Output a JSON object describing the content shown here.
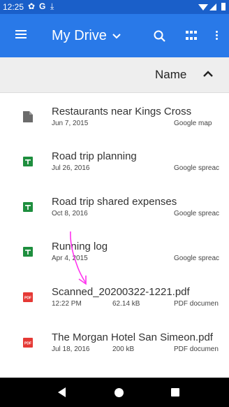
{
  "status_bar": {
    "time": "12:25",
    "icons": [
      "gear-icon",
      "google-g-icon",
      "download-icon",
      "wifi-icon",
      "signal-icon",
      "battery-icon"
    ]
  },
  "app_bar": {
    "title": "My Drive",
    "bg_color": "#2979e8"
  },
  "sort_bar": {
    "label": "Name"
  },
  "files": [
    {
      "name": "Restaurants near Kings Cross",
      "date": "Jun 7, 2015",
      "size": "",
      "type": "Google map",
      "icon": "file-icon"
    },
    {
      "name": "Road trip planning",
      "date": "Jul 26, 2016",
      "size": "",
      "type": "Google spreac",
      "icon": "sheets-icon"
    },
    {
      "name": "Road trip shared expenses",
      "date": "Oct 8, 2016",
      "size": "",
      "type": "Google spreac",
      "icon": "sheets-icon"
    },
    {
      "name": "Running log",
      "date": "Apr 4, 2015",
      "size": "",
      "type": "Google spreac",
      "icon": "sheets-icon"
    },
    {
      "name": "Scanned_20200322-1221.pdf",
      "date": "12:22 PM",
      "size": "62.14 kB",
      "type": "PDF documen",
      "icon": "pdf-icon"
    },
    {
      "name": "The Morgan Hotel San Simeon.pdf",
      "date": "Jul 18, 2016",
      "size": "200 kB",
      "type": "PDF documen",
      "icon": "pdf-icon"
    }
  ],
  "colors": {
    "sheets_green": "#1e8e3e",
    "pdf_red": "#e53935",
    "annotation_magenta": "#ff33ee"
  }
}
